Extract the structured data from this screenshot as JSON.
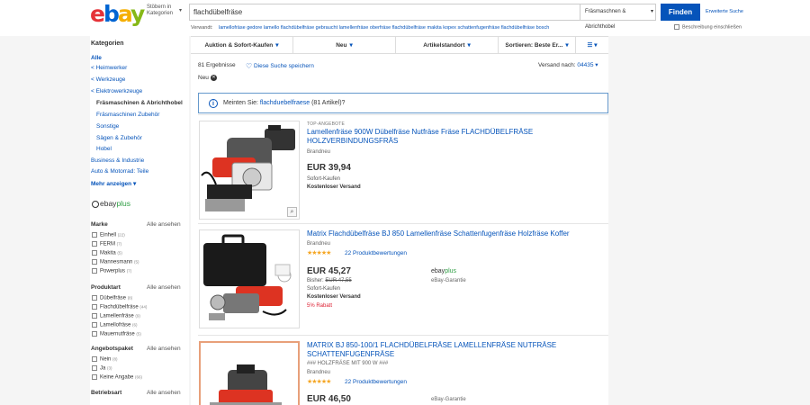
{
  "header": {
    "logo": {
      "e": "e",
      "b": "b",
      "a": "a",
      "y": "y"
    },
    "browse_label": "Stöbern in Kategorien",
    "search_value": "flachdübelfräse",
    "category": "Fräsmaschnen & Abrichthobel",
    "find_button": "Finden",
    "advanced": "Erweiterte Suche",
    "related_label": "Verwandt:",
    "related": [
      "lamellofräse",
      "gedore",
      "lamello",
      "flachdübelfräse gebraucht",
      "lamellenfräse",
      "oberfräse",
      "flachdübelfräse makita",
      "kopex",
      "schattenfugenfräse",
      "flachdübelfräse bosch"
    ],
    "desc_checkbox": "Beschreibung einschließen"
  },
  "sidebar": {
    "heading": "Kategorien",
    "all": "Alle",
    "crumbs": [
      "Heimwerker",
      "Werkzeuge",
      "Elektrowerkzeuge"
    ],
    "selected": "Fräsmaschinen & Abrichthobel",
    "subs": [
      "Fräsmaschinen Zubehör",
      "Sonstige",
      "Sägen & Zubehör",
      "Hobel"
    ],
    "others": [
      "Business & Industrie",
      "Auto & Motorrad: Teile"
    ],
    "more": "Mehr anzeigen",
    "ebayplus": {
      "ebay": "ebay",
      "plus": "plus"
    },
    "facets": [
      {
        "title": "Marke",
        "all": "Alle ansehen",
        "options": [
          {
            "label": "Einhell",
            "count": "(22)"
          },
          {
            "label": "FERM",
            "count": "(7)"
          },
          {
            "label": "Makita",
            "count": "(5)"
          },
          {
            "label": "Mannesmann",
            "count": "(5)"
          },
          {
            "label": "Powerplus",
            "count": "(7)"
          }
        ]
      },
      {
        "title": "Produktart",
        "all": "Alle ansehen",
        "options": [
          {
            "label": "Dübelfräse",
            "count": "(8)"
          },
          {
            "label": "Flachdübelfräse",
            "count": "(44)"
          },
          {
            "label": "Lamellenfräse",
            "count": "(9)"
          },
          {
            "label": "Lamellofräse",
            "count": "(6)"
          },
          {
            "label": "Mauernutfräse",
            "count": "(5)"
          }
        ]
      },
      {
        "title": "Angebotspaket",
        "all": "Alle ansehen",
        "options": [
          {
            "label": "Nein",
            "count": "(8)"
          },
          {
            "label": "Ja",
            "count": "(3)"
          },
          {
            "label": "Keine Angabe",
            "count": "(66)"
          }
        ]
      },
      {
        "title": "Betriebsart",
        "all": "Alle ansehen",
        "options": []
      }
    ]
  },
  "main": {
    "filters": [
      "Auktion & Sofort-Kaufen",
      "Neu",
      "Artikelstandort",
      "Sortieren: Beste Er..."
    ],
    "results": "81 Ergebnisse",
    "save_search": "Diese Suche speichern",
    "ship_label": "Versand nach:",
    "ship_zip": "04435",
    "condition": "Neu",
    "did_you_mean": {
      "prefix": "Meinten Sie:",
      "link": "flachduebelfraese",
      "suffix": "(81 Artikel)?"
    },
    "listings": [
      {
        "badge": "TOP-ANGEBOTE",
        "title": "Lamellenfräse 900W Dübelfräse Nutfräse Fräse FLACHDÜBELFRÄSE HOLZVERBINDUNGSFRÄS",
        "brand": "Brandneu",
        "price": "EUR 39,94",
        "buy": "Sofort-Kaufen",
        "shipping": "Kostenloser Versand"
      },
      {
        "title": "Matrix Flachdübelfräse BJ 850 Lamellenfräse Schattenfugenfräse Holzfräse Koffer",
        "brand": "Brandneu",
        "stars": "★★★★★",
        "reviews": "22 Produktbewertungen",
        "price": "EUR 45,27",
        "was_label": "Bisher:",
        "was": "EUR 47,55",
        "buy": "Sofort-Kaufen",
        "shipping": "Kostenloser Versand",
        "discount": "5% Rabatt",
        "plus": {
          "ebay": "ebay",
          "plus": "plus"
        },
        "guarantee": "eBay-Garantie"
      },
      {
        "title": "MATRIX BJ 850-100/1 FLACHDÜBELFRÄSE LAMELLENFRÄSE NUTFRÄSE SCHATTENFUGENFRÄSE",
        "subtitle": "### HOLZFRÄSE MIT 900 W ###",
        "brand": "Brandneu",
        "stars": "★★★★★",
        "reviews": "22 Produktbewertungen",
        "price": "EUR 46,50",
        "guarantee": "eBay-Garantie"
      }
    ]
  }
}
